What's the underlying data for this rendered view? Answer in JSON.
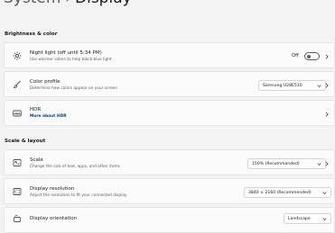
{
  "header": {
    "crumb": "System",
    "separator": "›",
    "title": "Display"
  },
  "sections": {
    "brightness_color": "Brightness & color",
    "scale_layout": "Scale & layout"
  },
  "night_light": {
    "label": "Night light (off until 5:34 PM)",
    "desc": "Use warmer colors to help block blue light",
    "state_label": "Off",
    "on": false
  },
  "color_profile": {
    "label": "Color profile",
    "desc": "Determine how colors appear on your screen",
    "value": "Samsung U28E510"
  },
  "hdr": {
    "label": "HDR",
    "link": "More about HDR"
  },
  "scale": {
    "label": "Scale",
    "desc": "Change the size of text, apps, and other items",
    "value": "150% (Recommended)"
  },
  "resolution": {
    "label": "Display resolution",
    "desc": "Adjust the resolution to fit your connected display",
    "value": "3840 × 2160 (Recommended)"
  },
  "orientation": {
    "label": "Display orientation",
    "value": "Landscape"
  },
  "icons": {
    "night_light": "sun-icon",
    "color_profile": "brush-icon",
    "hdr": "hdr-icon",
    "scale": "scale-icon",
    "resolution": "resolution-icon",
    "orientation": "orientation-icon"
  }
}
